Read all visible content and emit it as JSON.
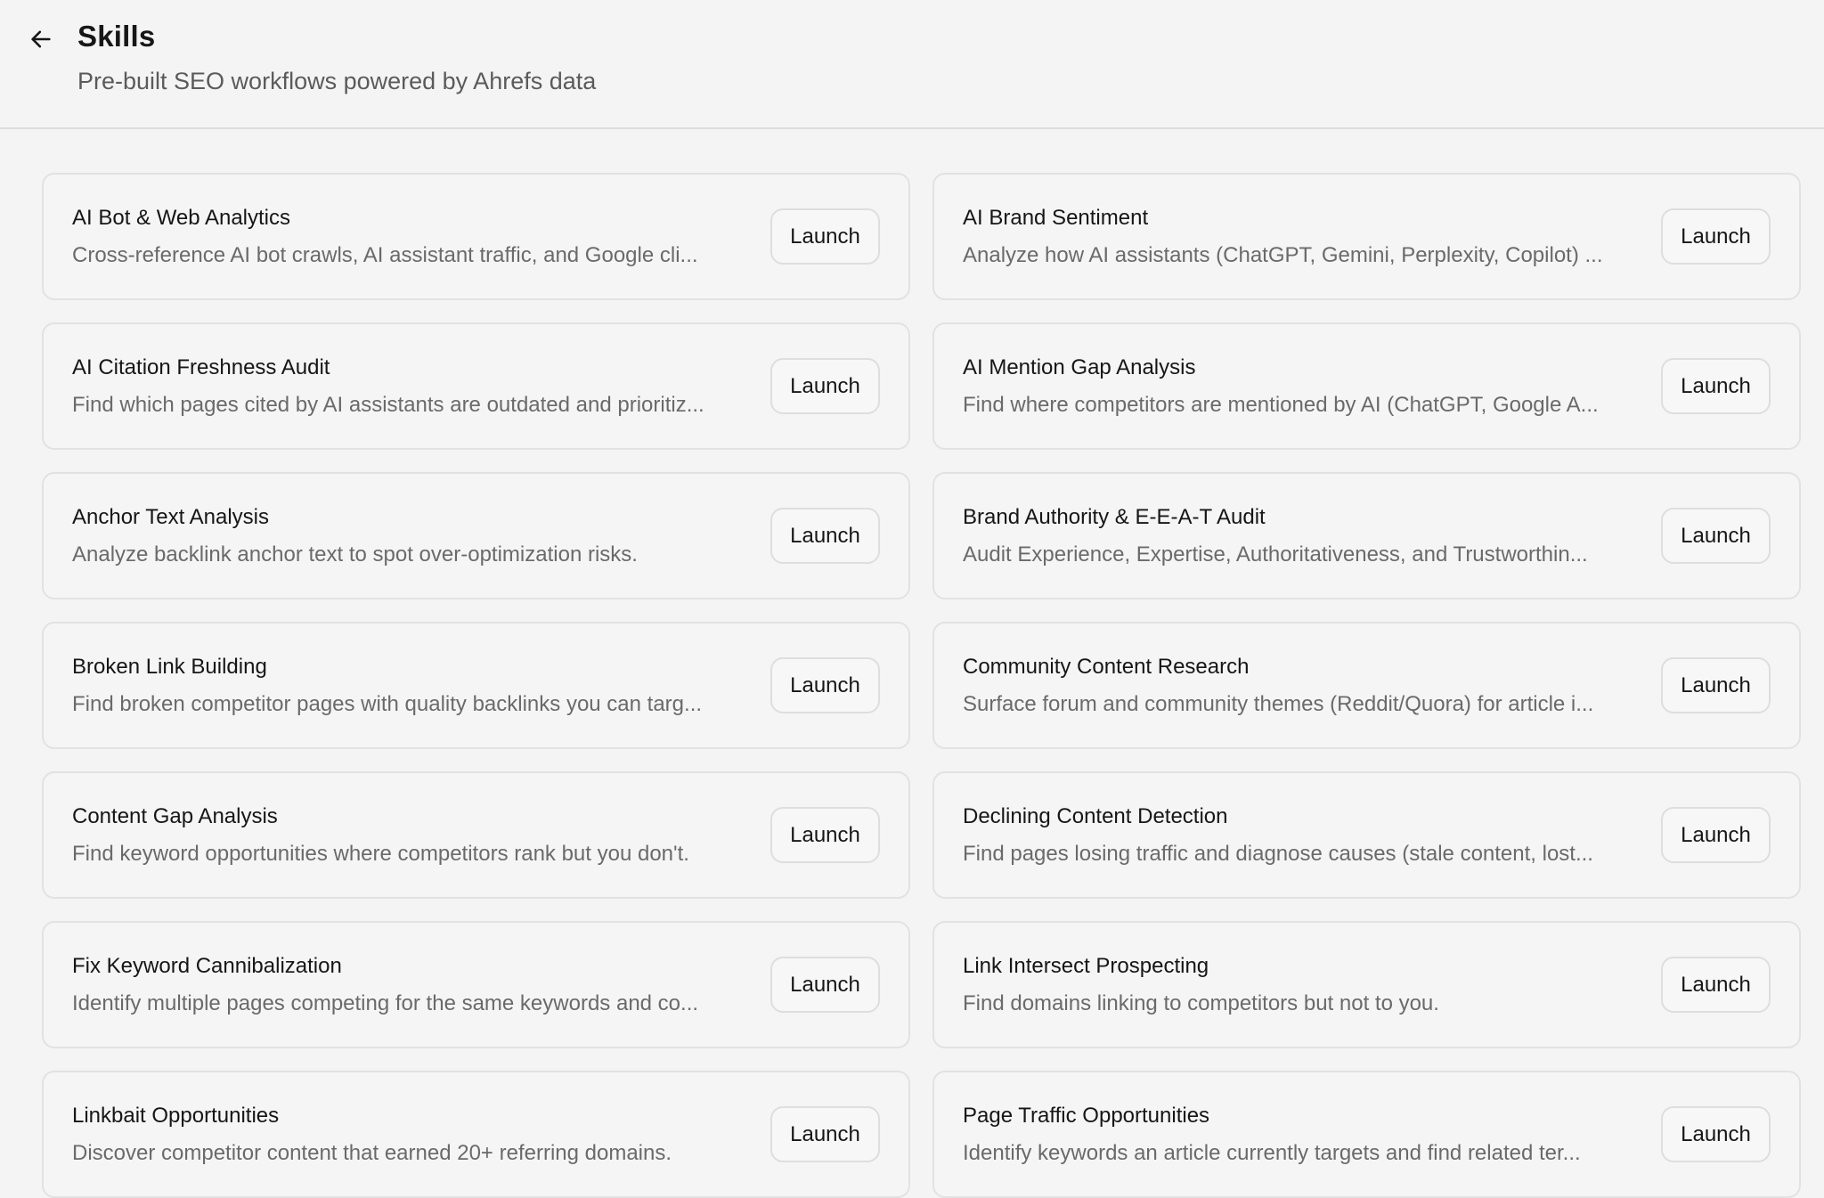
{
  "header": {
    "title": "Skills",
    "subtitle": "Pre-built SEO workflows powered by Ahrefs data"
  },
  "icons": {
    "back": "arrow-left-icon"
  },
  "launch_label": "Launch",
  "skills": [
    {
      "title": "AI Bot & Web Analytics",
      "description": "Cross-reference AI bot crawls, AI assistant traffic, and Google cli..."
    },
    {
      "title": "AI Brand Sentiment",
      "description": "Analyze how AI assistants (ChatGPT, Gemini, Perplexity, Copilot) ..."
    },
    {
      "title": "AI Citation Freshness Audit",
      "description": "Find which pages cited by AI assistants are outdated and prioritiz..."
    },
    {
      "title": "AI Mention Gap Analysis",
      "description": "Find where competitors are mentioned by AI (ChatGPT, Google A..."
    },
    {
      "title": "Anchor Text Analysis",
      "description": "Analyze backlink anchor text to spot over-optimization risks."
    },
    {
      "title": "Brand Authority & E-E-A-T Audit",
      "description": "Audit Experience, Expertise, Authoritativeness, and Trustworthin..."
    },
    {
      "title": "Broken Link Building",
      "description": "Find broken competitor pages with quality backlinks you can targ..."
    },
    {
      "title": "Community Content Research",
      "description": "Surface forum and community themes (Reddit/Quora) for article i..."
    },
    {
      "title": "Content Gap Analysis",
      "description": "Find keyword opportunities where competitors rank but you don't."
    },
    {
      "title": "Declining Content Detection",
      "description": "Find pages losing traffic and diagnose causes (stale content, lost..."
    },
    {
      "title": "Fix Keyword Cannibalization",
      "description": "Identify multiple pages competing for the same keywords and co..."
    },
    {
      "title": "Link Intersect Prospecting",
      "description": "Find domains linking to competitors but not to you."
    },
    {
      "title": "Linkbait Opportunities",
      "description": "Discover competitor content that earned 20+ referring domains."
    },
    {
      "title": "Page Traffic Opportunities",
      "description": "Identify keywords an article currently targets and find related ter..."
    }
  ]
}
